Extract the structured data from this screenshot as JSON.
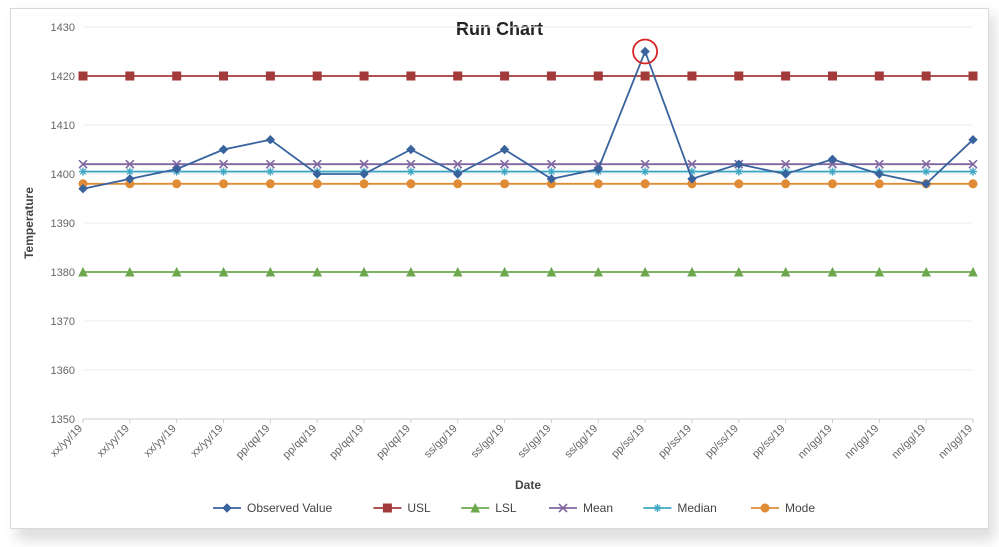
{
  "chart_data": {
    "type": "line",
    "title": "Run Chart",
    "xlabel": "Date",
    "ylabel": "Temperature",
    "ylim": [
      1350,
      1430
    ],
    "yticks": [
      1350,
      1360,
      1370,
      1380,
      1390,
      1400,
      1410,
      1420,
      1430
    ],
    "categories": [
      "xx/yy/19",
      "xx/yy/19",
      "xx/yy/19",
      "xx/yy/19",
      "pp/qq/19",
      "pp/qq/19",
      "pp/qq/19",
      "pp/qq/19",
      "ss/gg/19",
      "ss/gg/19",
      "ss/gg/19",
      "ss/gg/19",
      "pp/ss/19",
      "pp/ss/19",
      "pp/ss/19",
      "pp/ss/19",
      "nn/gg/19",
      "nn/gg/19",
      "nn/gg/19",
      "nn/gg/19"
    ],
    "series": [
      {
        "name": "Observed Value",
        "color": "#39639d",
        "marker": "diamond",
        "values": [
          1397,
          1399,
          1401,
          1405,
          1407,
          1400,
          1400,
          1405,
          1400,
          1405,
          1399,
          1401,
          1425,
          1399,
          1402,
          1400,
          1403,
          1400,
          1398,
          1407
        ]
      },
      {
        "name": "USL",
        "color": "#a33a3a",
        "marker": "square",
        "values": [
          1420,
          1420,
          1420,
          1420,
          1420,
          1420,
          1420,
          1420,
          1420,
          1420,
          1420,
          1420,
          1420,
          1420,
          1420,
          1420,
          1420,
          1420,
          1420,
          1420
        ]
      },
      {
        "name": "LSL",
        "color": "#6da84f",
        "marker": "triangle",
        "values": [
          1380,
          1380,
          1380,
          1380,
          1380,
          1380,
          1380,
          1380,
          1380,
          1380,
          1380,
          1380,
          1380,
          1380,
          1380,
          1380,
          1380,
          1380,
          1380,
          1380
        ]
      },
      {
        "name": "Mean",
        "color": "#8066a0",
        "marker": "x",
        "values": [
          1402,
          1402,
          1402,
          1402,
          1402,
          1402,
          1402,
          1402,
          1402,
          1402,
          1402,
          1402,
          1402,
          1402,
          1402,
          1402,
          1402,
          1402,
          1402,
          1402
        ]
      },
      {
        "name": "Median",
        "color": "#3fa7c4",
        "marker": "star",
        "values": [
          1400.5,
          1400.5,
          1400.5,
          1400.5,
          1400.5,
          1400.5,
          1400.5,
          1400.5,
          1400.5,
          1400.5,
          1400.5,
          1400.5,
          1400.5,
          1400.5,
          1400.5,
          1400.5,
          1400.5,
          1400.5,
          1400.5,
          1400.5
        ]
      },
      {
        "name": "Mode",
        "color": "#e08b35",
        "marker": "circle",
        "values": [
          1398,
          1398,
          1398,
          1398,
          1398,
          1398,
          1398,
          1398,
          1398,
          1398,
          1398,
          1398,
          1398,
          1398,
          1398,
          1398,
          1398,
          1398,
          1398,
          1398
        ]
      }
    ],
    "annotations": [
      {
        "type": "outlier-circle",
        "index": 12,
        "series": "Observed Value",
        "color": "#d62424"
      }
    ],
    "legend": {
      "position": "bottom",
      "items": [
        "Observed Value",
        "USL",
        "LSL",
        "Mean",
        "Median",
        "Mode"
      ]
    }
  }
}
